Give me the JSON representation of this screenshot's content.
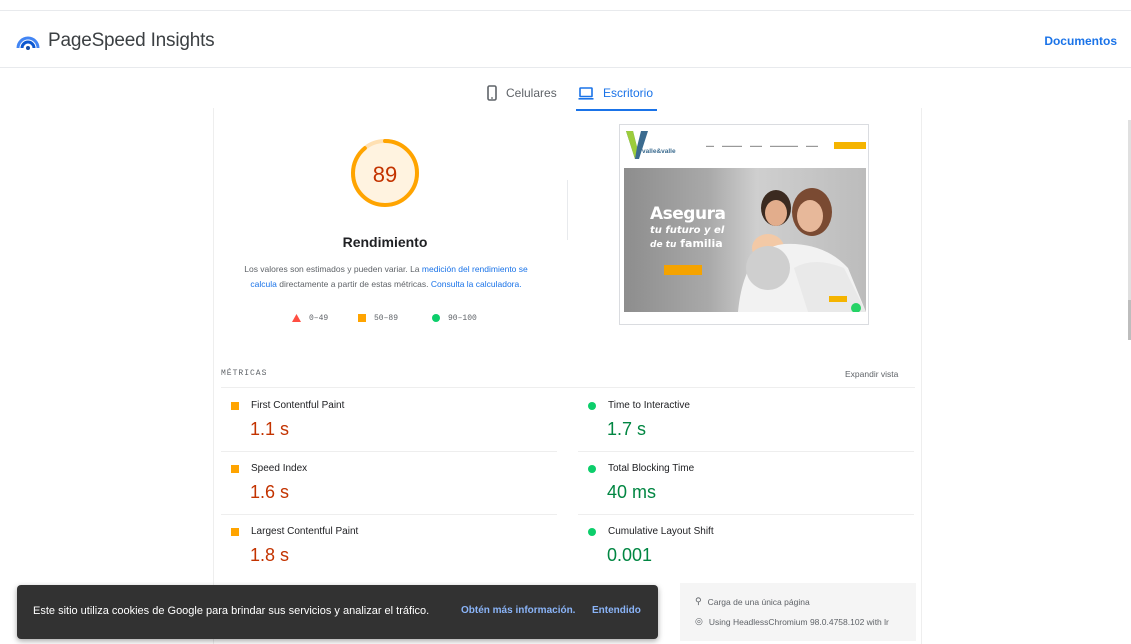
{
  "app": {
    "title": "PageSpeed Insights",
    "docs_link": "Documentos"
  },
  "tabs": [
    {
      "label": "Celulares",
      "icon": "smartphone-icon",
      "selected": false
    },
    {
      "label": "Escritorio",
      "icon": "laptop-icon",
      "selected": true
    }
  ],
  "performance": {
    "score": "89",
    "score_fraction": 0.89,
    "title": "Rendimiento",
    "desc_before": "Los valores son estimados y pueden variar. La ",
    "desc_link1": "medición del rendimiento se calcula",
    "desc_middle": " directamente a partir de estas métricas. ",
    "desc_link2": "Consulta la calculadora."
  },
  "legend": [
    {
      "range": "0–49",
      "shape": "triangle",
      "color": "#ff4e42"
    },
    {
      "range": "50–89",
      "shape": "square",
      "color": "#ffa400"
    },
    {
      "range": "90–100",
      "shape": "circle",
      "color": "#0cce6b"
    }
  ],
  "screenshot": {
    "brand": "valle&valle",
    "headline1": "Asegura",
    "headline2": "tu futuro y el",
    "headline3_prefix": "de tu",
    "headline3_word": "familia"
  },
  "metrics": {
    "title": "MÉTRICAS",
    "expand": "Expandir vista",
    "items": [
      {
        "name": "First Contentful Paint",
        "value": "1.1 s",
        "rating": "avg"
      },
      {
        "name": "Time to Interactive",
        "value": "1.7 s",
        "rating": "pass"
      },
      {
        "name": "Speed Index",
        "value": "1.6 s",
        "rating": "avg"
      },
      {
        "name": "Total Blocking Time",
        "value": "40 ms",
        "rating": "pass"
      },
      {
        "name": "Largest Contentful Paint",
        "value": "1.8 s",
        "rating": "avg"
      },
      {
        "name": "Cumulative Layout Shift",
        "value": "0.001",
        "rating": "pass"
      }
    ]
  },
  "info": {
    "load_type": "Carga de una única página",
    "browser": "Using HeadlessChromium 98.0.4758.102 with lr"
  },
  "cookie": {
    "text": "Este sitio utiliza cookies de Google para brindar sus servicios y analizar el tráfico.",
    "more": "Obtén más información.",
    "ok": "Entendido"
  },
  "colors": {
    "accent": "#1a73e8",
    "fail": "#ff4e42",
    "average": "#ffa400",
    "average_text": "#c33300",
    "pass": "#0cce6b",
    "pass_text": "#018642"
  }
}
